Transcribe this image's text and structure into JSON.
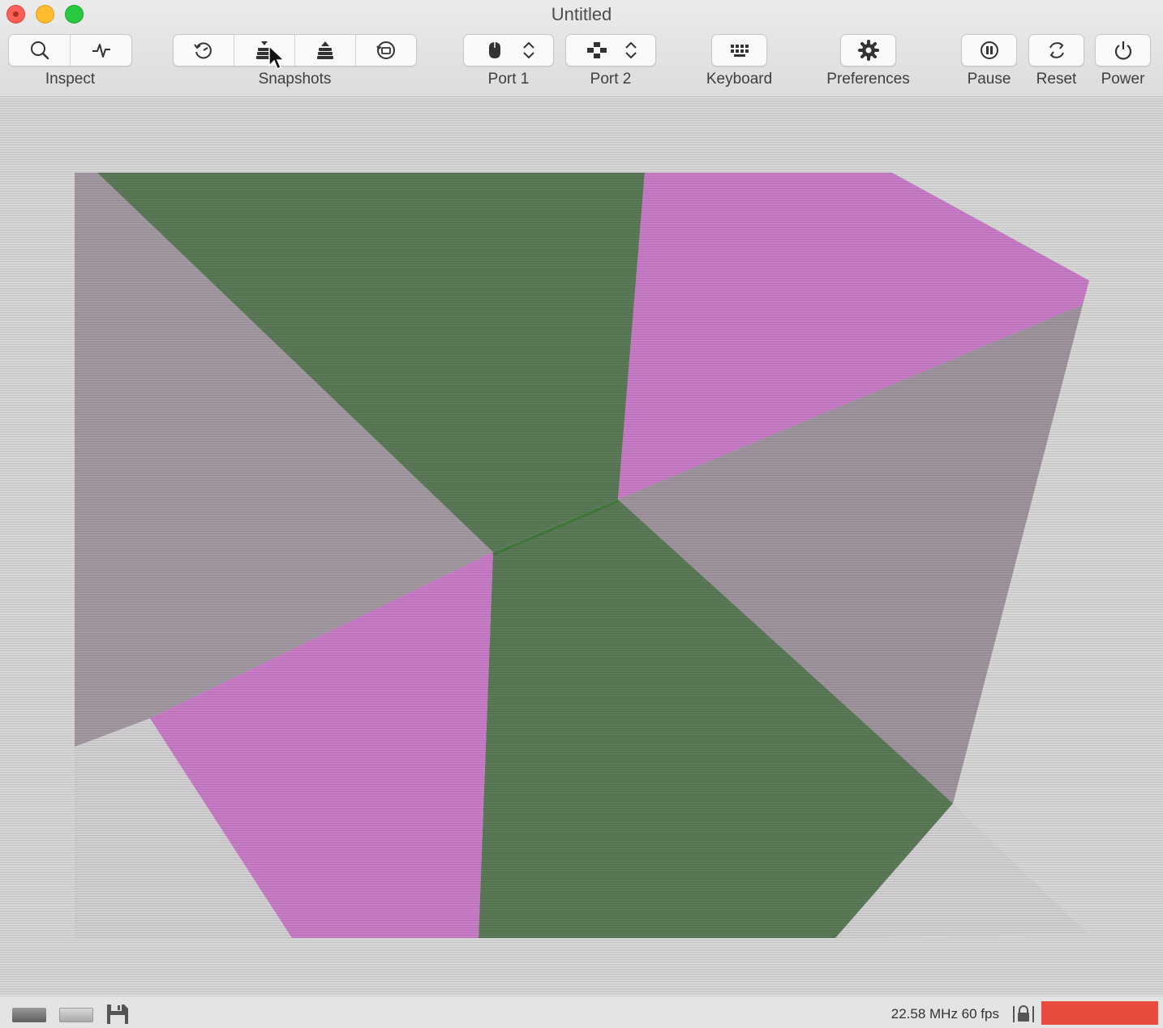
{
  "window": {
    "title": "Untitled"
  },
  "toolbar": {
    "inspect_label": "Inspect",
    "snapshots_label": "Snapshots",
    "port1_label": "Port 1",
    "port2_label": "Port 2",
    "keyboard_label": "Keyboard",
    "preferences_label": "Preferences",
    "pause_label": "Pause",
    "reset_label": "Reset",
    "power_label": "Power"
  },
  "status": {
    "speed_text": "22.58 MHz 60 fps",
    "activity_color": "#e84c3d"
  },
  "colors": {
    "face_green": "#5b7a58",
    "face_pink": "#c97cc7",
    "face_grey": "#a0959f",
    "background": "#dcdcdc"
  }
}
